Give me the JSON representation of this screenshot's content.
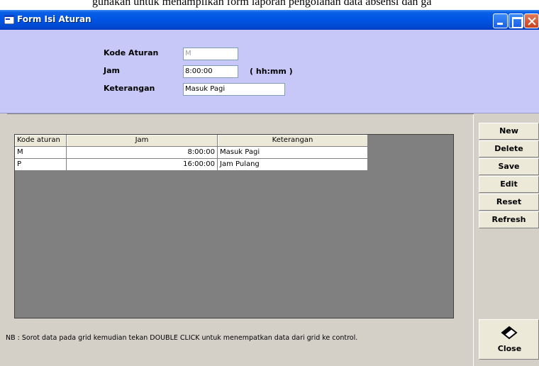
{
  "doc_caption": "gunakan untuk menampilkan form laporan pengolahan data absensi dan ga",
  "window": {
    "title": "Form Isi Aturan"
  },
  "form": {
    "kode_label": "Kode Aturan",
    "kode_value": "M",
    "jam_label": "Jam",
    "jam_value": "8:00:00",
    "jam_hint": "( hh:mm )",
    "keterangan_label": "Keterangan",
    "keterangan_value": "Masuk Pagi"
  },
  "grid": {
    "headers": [
      "Kode aturan",
      "Jam",
      "Keterangan"
    ],
    "rows": [
      [
        "M",
        "8:00:00",
        "Masuk Pagi"
      ],
      [
        "P",
        "16:00:00",
        "Jam Pulang"
      ]
    ]
  },
  "note": "NB : Sorot data pada grid kemudian tekan DOUBLE CLICK untuk menempatkan data dari grid ke control.",
  "buttons": {
    "new": "New",
    "delete": "Delete",
    "save": "Save",
    "edit": "Edit",
    "reset": "Reset",
    "refresh": "Refresh",
    "close": "Close"
  },
  "colors": {
    "header_panel": "#c8c8f8",
    "grid_bg": "#808080",
    "titlebar": "#0054e3"
  },
  "icons": [
    "form-icon",
    "minimize-icon",
    "maximize-icon",
    "close-window-icon",
    "eraser-icon"
  ]
}
